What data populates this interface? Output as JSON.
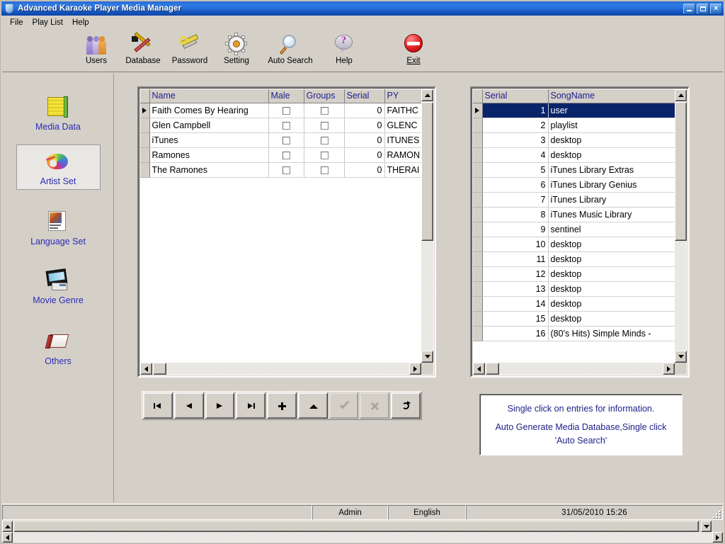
{
  "window": {
    "title": "Advanced Karaoke Player Media Manager",
    "icon": "app-shield-icon",
    "minimize_label": "",
    "maximize_label": "",
    "close_label": "×"
  },
  "menu": {
    "items": [
      {
        "label": "File"
      },
      {
        "label": "Play List"
      },
      {
        "label": "Help"
      }
    ]
  },
  "toolbar": {
    "buttons": [
      {
        "label": "Users",
        "icon": "users-icon"
      },
      {
        "label": "Database",
        "icon": "database-tools-icon"
      },
      {
        "label": "Password",
        "icon": "key-icon"
      },
      {
        "label": "Setting",
        "icon": "gear-icon"
      },
      {
        "label": "Auto Search",
        "icon": "magnifier-icon"
      },
      {
        "label": "Help",
        "icon": "help-balloon-icon"
      },
      {
        "label": "Exit",
        "icon": "exit-sign-icon"
      }
    ]
  },
  "sidebar": {
    "items": [
      {
        "label": "Media Data",
        "icon": "media-data-icon",
        "selected": false
      },
      {
        "label": "Artist Set",
        "icon": "artist-palette-icon",
        "selected": true
      },
      {
        "label": "Language Set",
        "icon": "language-note-icon",
        "selected": false
      },
      {
        "label": "Movie Genre",
        "icon": "movie-film-icon",
        "selected": false
      },
      {
        "label": "Others",
        "icon": "others-book-icon",
        "selected": false
      }
    ]
  },
  "artist_grid": {
    "columns": [
      "Name",
      "Male",
      "Groups",
      "Serial",
      "PY"
    ],
    "rows": [
      {
        "indicator": true,
        "name": "Faith Comes By Hearing",
        "male": false,
        "groups": false,
        "serial": "0",
        "py": "FAITHC"
      },
      {
        "indicator": false,
        "name": "Glen Campbell",
        "male": false,
        "groups": false,
        "serial": "0",
        "py": "GLENC"
      },
      {
        "indicator": false,
        "name": "iTunes",
        "male": false,
        "groups": false,
        "serial": "0",
        "py": "ITUNES"
      },
      {
        "indicator": false,
        "name": "Ramones",
        "male": false,
        "groups": false,
        "serial": "0",
        "py": "RAMON"
      },
      {
        "indicator": false,
        "name": "The Ramones",
        "male": false,
        "groups": false,
        "serial": "0",
        "py": "THERAI"
      }
    ]
  },
  "song_grid": {
    "columns": [
      "Serial",
      "SongName"
    ],
    "rows": [
      {
        "indicator": true,
        "selected": true,
        "serial": "1",
        "song": "user"
      },
      {
        "indicator": false,
        "selected": false,
        "serial": "2",
        "song": "playlist"
      },
      {
        "indicator": false,
        "selected": false,
        "serial": "3",
        "song": "desktop"
      },
      {
        "indicator": false,
        "selected": false,
        "serial": "4",
        "song": "desktop"
      },
      {
        "indicator": false,
        "selected": false,
        "serial": "5",
        "song": "iTunes Library Extras"
      },
      {
        "indicator": false,
        "selected": false,
        "serial": "6",
        "song": "iTunes Library Genius"
      },
      {
        "indicator": false,
        "selected": false,
        "serial": "7",
        "song": "iTunes Library"
      },
      {
        "indicator": false,
        "selected": false,
        "serial": "8",
        "song": "iTunes Music Library"
      },
      {
        "indicator": false,
        "selected": false,
        "serial": "9",
        "song": "sentinel"
      },
      {
        "indicator": false,
        "selected": false,
        "serial": "10",
        "song": "desktop"
      },
      {
        "indicator": false,
        "selected": false,
        "serial": "11",
        "song": "desktop"
      },
      {
        "indicator": false,
        "selected": false,
        "serial": "12",
        "song": "desktop"
      },
      {
        "indicator": false,
        "selected": false,
        "serial": "13",
        "song": "desktop"
      },
      {
        "indicator": false,
        "selected": false,
        "serial": "14",
        "song": "desktop"
      },
      {
        "indicator": false,
        "selected": false,
        "serial": "15",
        "song": "desktop"
      },
      {
        "indicator": false,
        "selected": false,
        "serial": "16",
        "song": "(80's Hits) Simple Minds -"
      }
    ]
  },
  "navigator": {
    "buttons": [
      {
        "name": "first",
        "icon": "first-record-icon",
        "enabled": true
      },
      {
        "name": "prior",
        "icon": "prior-record-icon",
        "enabled": true
      },
      {
        "name": "next",
        "icon": "next-record-icon",
        "enabled": true
      },
      {
        "name": "last",
        "icon": "last-record-icon",
        "enabled": true
      },
      {
        "name": "insert",
        "icon": "plus-icon",
        "enabled": true
      },
      {
        "name": "delete",
        "icon": "triangle-up-icon",
        "enabled": true
      },
      {
        "name": "post",
        "icon": "check-icon",
        "enabled": false
      },
      {
        "name": "cancel",
        "icon": "cross-icon",
        "enabled": false
      },
      {
        "name": "refresh",
        "icon": "refresh-icon",
        "enabled": true
      }
    ]
  },
  "hint": {
    "line1": "Single click on entries for information.",
    "line2": "Auto Generate Media Database,Single click 'Auto Search'"
  },
  "statusbar": {
    "panel_empty": "",
    "user": "Admin",
    "language": "English",
    "datetime": "31/05/2010   15:26"
  },
  "colors": {
    "face": "#d4d0c8",
    "title_blue": "#2a72dd",
    "header_text": "#20208c",
    "link_blue": "#2b2bb5",
    "selection": "#0a246a"
  }
}
